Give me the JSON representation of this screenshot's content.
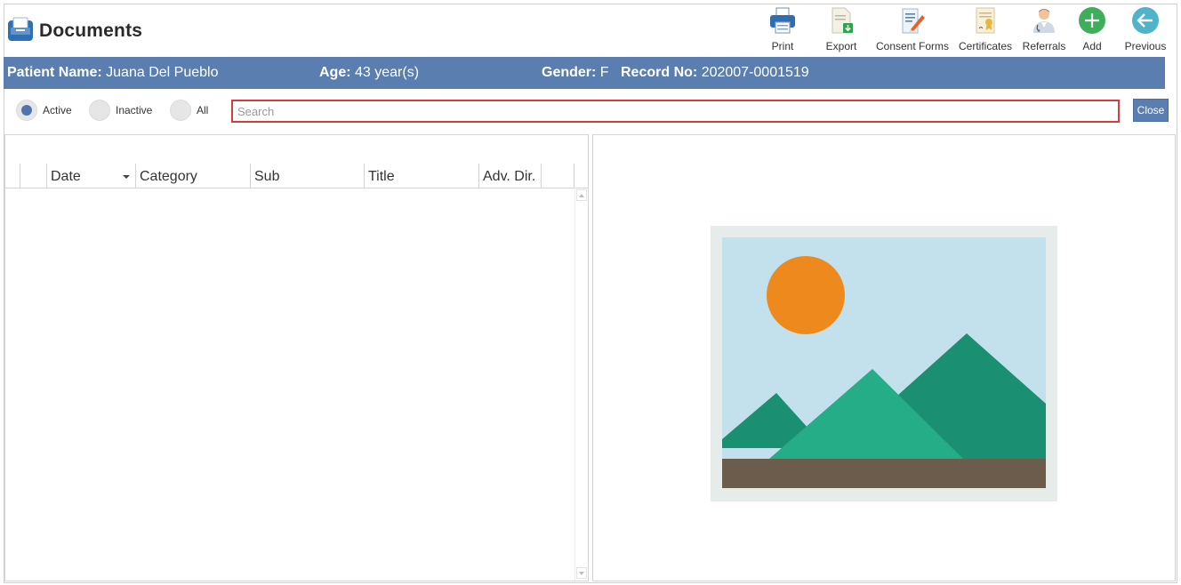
{
  "app": {
    "title": "Documents",
    "icon": "document-tray-icon"
  },
  "toolbar": {
    "buttons": [
      {
        "label": "Print",
        "icon": "printer-icon"
      },
      {
        "label": "Export",
        "icon": "export-icon"
      },
      {
        "label": "Consent Forms",
        "icon": "consent-forms-icon"
      },
      {
        "label": "Certificates",
        "icon": "certificate-icon"
      },
      {
        "label": "Referrals",
        "icon": "referrals-icon"
      },
      {
        "label": "Add",
        "icon": "add-icon"
      },
      {
        "label": "Previous",
        "icon": "arrow-left-icon"
      }
    ]
  },
  "patient": {
    "name_label": "Patient Name:",
    "name_value": "Juana Del Pueblo",
    "age_label": "Age:",
    "age_value": "43 year(s)",
    "gender_label": "Gender:",
    "gender_value": "F",
    "record_label": "Record No:",
    "record_value": "202007-0001519"
  },
  "filters": {
    "options": [
      {
        "label": "Active",
        "selected": true
      },
      {
        "label": "Inactive",
        "selected": false
      },
      {
        "label": "All",
        "selected": false
      }
    ]
  },
  "search": {
    "placeholder": "Search",
    "value": ""
  },
  "close_button": {
    "label": "Close"
  },
  "grid": {
    "columns": [
      "Date",
      "Category",
      "Sub",
      "Title",
      "Adv. Dir."
    ],
    "sort_column": "Date",
    "rows": []
  },
  "preview": {
    "icon": "image-placeholder-icon"
  },
  "colors": {
    "accent": "#5a7eaf",
    "highlight_border": "#d43c40",
    "add_green": "#3fae5b",
    "previous_teal": "#4fb3c9"
  }
}
